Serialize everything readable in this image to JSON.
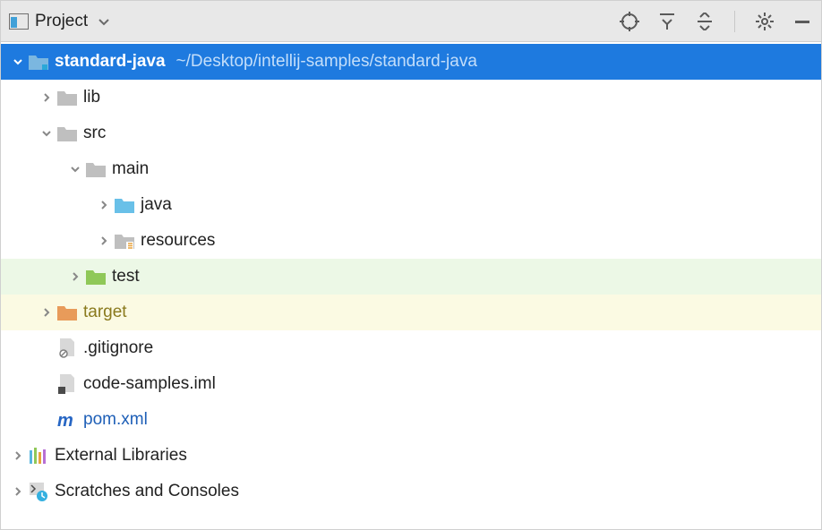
{
  "toolbar": {
    "title": "Project"
  },
  "tree": {
    "root": {
      "name": "standard-java",
      "path": "~/Desktop/intellij-samples/standard-java"
    },
    "lib": "lib",
    "src": "src",
    "main": "main",
    "java": "java",
    "resources": "resources",
    "test": "test",
    "target": "target",
    "gitignore": ".gitignore",
    "iml": "code-samples.iml",
    "pom": "pom.xml",
    "external": "External Libraries",
    "scratches": "Scratches and Consoles"
  }
}
